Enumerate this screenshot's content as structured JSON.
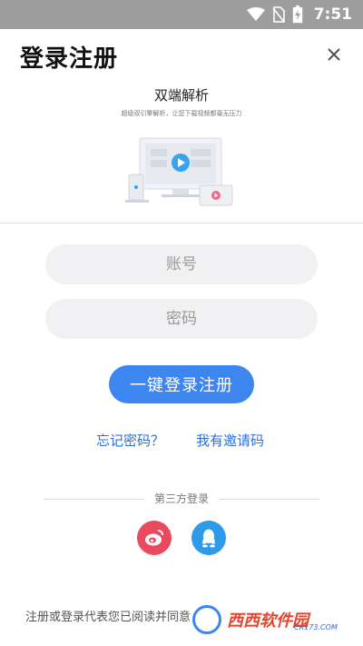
{
  "status_bar": {
    "time": "7:51",
    "icons": [
      "wifi-icon",
      "no-sim-icon",
      "battery-charging-icon"
    ]
  },
  "header": {
    "title": "登录注册",
    "close_icon": "close-icon"
  },
  "promo": {
    "title": "双端解析",
    "subtitle": "超级双引擎解析，让您下载视频都毫无压力"
  },
  "form": {
    "account_placeholder": "账号",
    "password_placeholder": "密码",
    "submit_label": "一键登录注册"
  },
  "links": {
    "forgot_password": "忘记密码？",
    "invite_code": "我有邀请码"
  },
  "third_party": {
    "label": "第三方登录",
    "providers": [
      {
        "name": "weibo",
        "icon": "weibo-icon",
        "color": "#e94a5e"
      },
      {
        "name": "qq",
        "icon": "qq-icon",
        "color": "#2f9ae8"
      }
    ]
  },
  "agreement": {
    "text": "注册或登录代表您已阅读并同意"
  },
  "watermark": {
    "text": "西西软件园",
    "sub": "CR173.COM"
  },
  "colors": {
    "accent": "#3d86f0",
    "link": "#2f6fd8",
    "status_bar": "#9e9e9e"
  }
}
